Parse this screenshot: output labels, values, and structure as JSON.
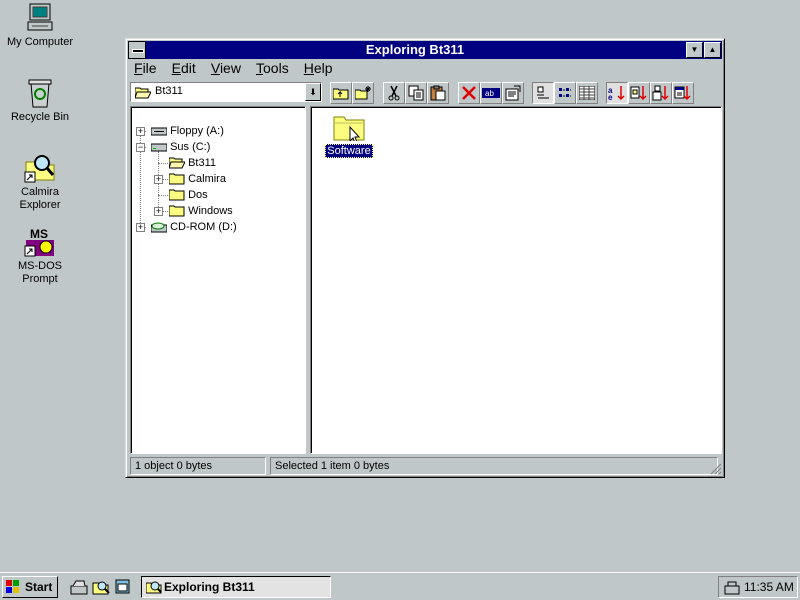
{
  "desktop": {
    "icons": [
      {
        "label": "My Computer"
      },
      {
        "label": "Recycle Bin"
      },
      {
        "label_line1": "Calmira",
        "label_line2": "Explorer"
      },
      {
        "label_line1": "MS-DOS",
        "label_line2": "Prompt",
        "logo_text": "MS"
      }
    ]
  },
  "window": {
    "title": "Exploring Bt311",
    "menu": [
      {
        "key": "F",
        "rest": "ile"
      },
      {
        "key": "E",
        "rest": "dit"
      },
      {
        "key": "V",
        "rest": "iew"
      },
      {
        "key": "T",
        "rest": "ools"
      },
      {
        "key": "H",
        "rest": "elp"
      }
    ],
    "location": "Bt311",
    "tree": [
      {
        "label": "Floppy (A:)",
        "icon": "floppy-drive-icon",
        "expander": "+"
      },
      {
        "label": "Sus (C:)",
        "icon": "hard-drive-icon",
        "expander": "−"
      },
      {
        "label": "Bt311",
        "icon": "open-folder-icon",
        "expander": ""
      },
      {
        "label": "Calmira",
        "icon": "folder-icon",
        "expander": "+"
      },
      {
        "label": "Dos",
        "icon": "folder-icon",
        "expander": ""
      },
      {
        "label": "Windows",
        "icon": "folder-icon",
        "expander": "+"
      },
      {
        "label": "CD-ROM (D:)",
        "icon": "cdrom-drive-icon",
        "expander": "+"
      }
    ],
    "content_items": [
      {
        "label": "Software",
        "icon": "folder-icon",
        "selected": true
      }
    ],
    "status": {
      "left": "1 object  0 bytes",
      "right": "Selected 1 item  0 bytes"
    }
  },
  "taskbar": {
    "start_label": "Start",
    "task_label": "Exploring Bt311",
    "clock": "11:35 AM"
  },
  "colors": {
    "desktop": "#c0c7c8",
    "titlebar": "#000080",
    "selection": "#000080",
    "folder": "#fcfc80"
  }
}
